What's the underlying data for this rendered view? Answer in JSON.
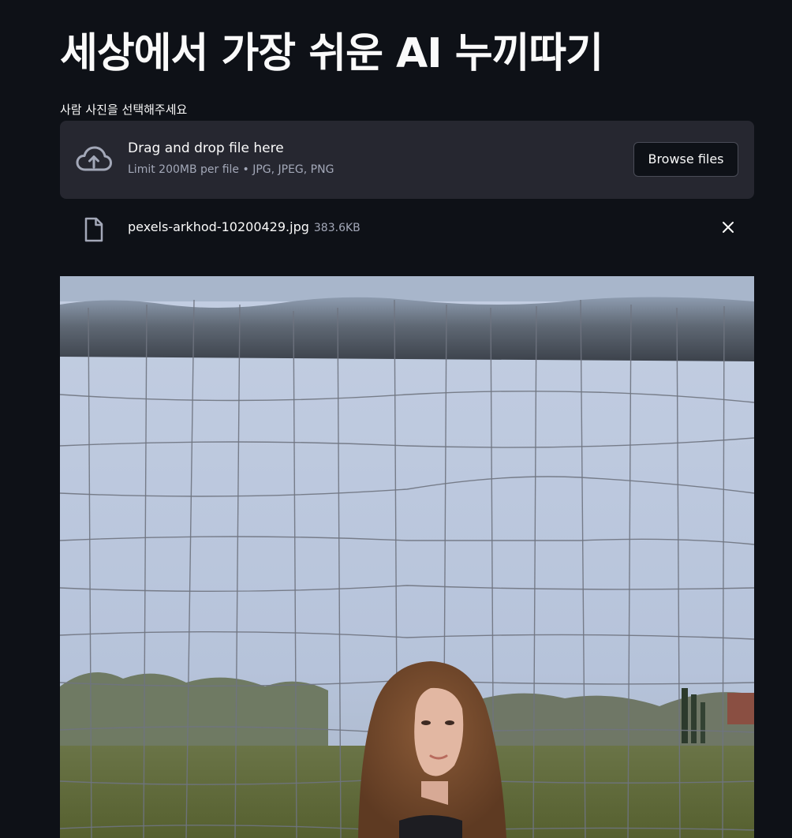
{
  "header": {
    "title": "세상에서 가장 쉬운 AI 누끼따기"
  },
  "uploader": {
    "label": "사람 사진을 선택해주세요",
    "drop_text": "Drag and drop file here",
    "limit_text": "Limit 200MB per file • JPG, JPEG, PNG",
    "browse_label": "Browse files",
    "cloud_icon": "cloud-upload-icon"
  },
  "file": {
    "name": "pexels-arkhod-10200429.jpg",
    "size": "383.6KB",
    "icon": "file-icon",
    "remove_icon": "close-icon"
  },
  "colors": {
    "background": "#0e1117",
    "dropzone": "#262730",
    "text": "#fafafa",
    "muted": "#a3a8b8"
  }
}
